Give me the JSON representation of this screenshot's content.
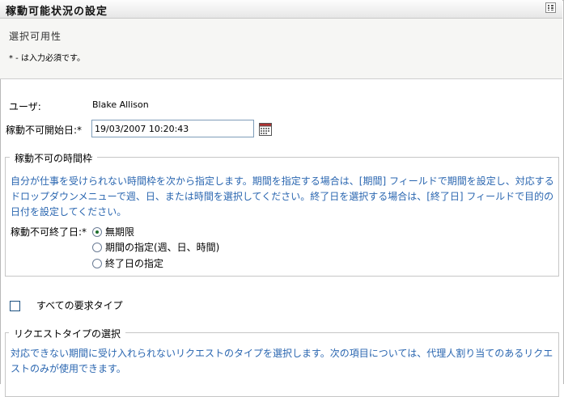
{
  "header": {
    "title": "稼動可能状況の設定",
    "menu_icon": "grid-menu-icon"
  },
  "subheader": {
    "subtitle": "選択可用性",
    "required_note": "* - は入力必須です。"
  },
  "form": {
    "user_label": "ユーザ:",
    "user_value": "Blake Allison",
    "start_date_label": "稼動不可開始日:*",
    "start_date_value": "19/03/2007 10:20:43",
    "calendar_icon": "calendar-icon"
  },
  "timeframe": {
    "legend": "稼動不可の時間枠",
    "info": "自分が仕事を受けられない時間枠を次から指定します。期間を指定する場合は、[期間] フィールドで期間を設定し、対応するドロップダウンメニューで週、日、または時間を選択してください。終了日を選択する場合は、[終了日] フィールドで目的の日付を設定してください。",
    "end_date_label": "稼動不可終了日:*",
    "options": [
      {
        "label": "無期限",
        "checked": true
      },
      {
        "label": "期間の指定(週、日、時間)",
        "checked": false
      },
      {
        "label": "終了日の指定",
        "checked": false
      }
    ]
  },
  "request_types": {
    "all_label": "すべての要求タイプ",
    "all_checked": false,
    "legend": "リクエストタイプの選択",
    "info": "対応できない期間に受け入れられないリクエストのタイプを選択します。次の項目については、代理人割り当てのあるリクエストのみが使用できます。"
  }
}
